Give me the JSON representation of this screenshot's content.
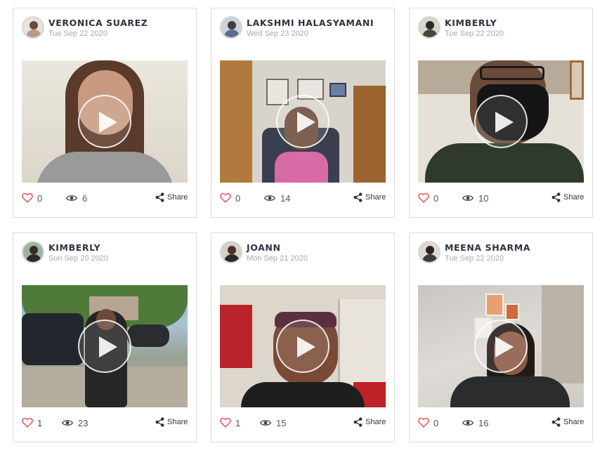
{
  "colors": {
    "heart": "#e8525a",
    "author": "#2f3340",
    "date": "#a3aab5",
    "border": "#dcdcdc"
  },
  "icons": {
    "like": "heart-icon",
    "views": "eye-icon",
    "share": "share-icon",
    "play": "play-icon"
  },
  "cards": [
    {
      "author": "VERONICA SUAREZ",
      "date": "Tue Sep 22 2020",
      "likes": "0",
      "views": "6",
      "share": "Share"
    },
    {
      "author": "LAKSHMI HALASYAMANI",
      "date": "Wed Sep 23 2020",
      "likes": "0",
      "views": "14",
      "share": "Share"
    },
    {
      "author": "KIMBERLY",
      "date": "Tue Sep 22 2020",
      "likes": "0",
      "views": "10",
      "share": "Share"
    },
    {
      "author": "KIMBERLY",
      "date": "Sun Sep 20 2020",
      "likes": "1",
      "views": "23",
      "share": "Share"
    },
    {
      "author": "JOANN",
      "date": "Mon Sep 21 2020",
      "likes": "1",
      "views": "15",
      "share": "Share"
    },
    {
      "author": "MEENA SHARMA",
      "date": "Tue Sep 22 2020",
      "likes": "0",
      "views": "16",
      "share": "Share"
    }
  ]
}
